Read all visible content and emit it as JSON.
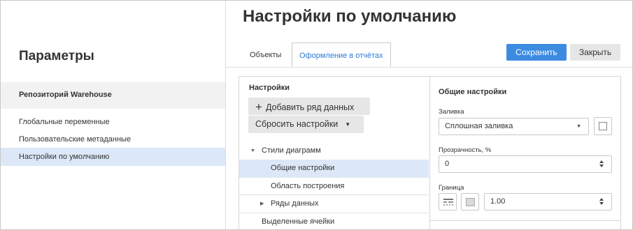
{
  "sidebar": {
    "title": "Параметры",
    "repository": "Репозиторий Warehouse",
    "items": [
      {
        "label": "Глобальные переменные"
      },
      {
        "label": "Пользовательские метаданные"
      },
      {
        "label": "Настройки по умолчанию"
      }
    ]
  },
  "main": {
    "title": "Настройки по умолчанию",
    "tabs": [
      {
        "label": "Объекты"
      },
      {
        "label": "Оформление в отчётах"
      }
    ],
    "buttons": {
      "save": "Сохранить",
      "close": "Закрыть"
    }
  },
  "left_panel": {
    "section_label": "Настройки",
    "add_series": "Добавить ряд данных",
    "reset_settings": "Сбросить настройки",
    "tree": [
      {
        "label": "Стили диаграмм"
      },
      {
        "label": "Общие настройки"
      },
      {
        "label": "Область построения"
      },
      {
        "label": "Ряды данных"
      },
      {
        "label": "Выделенные ячейки"
      }
    ]
  },
  "right_panel": {
    "title": "Общие настройки",
    "fill_label": "Заливка",
    "fill_value": "Сплошная заливка",
    "transparency_label": "Прозрачность, %",
    "transparency_value": "0",
    "border_label": "Граница",
    "border_width": "1.00"
  },
  "colors": {
    "accent": "#3d8be0",
    "selection": "#dce8f8",
    "tab_active_text": "#2d7ad6"
  },
  "icons": {
    "add": "plus-icon",
    "dropdown": "caret-down-icon",
    "tree_expanded": "triangle-down-icon",
    "tree_collapsed": "triangle-right-icon",
    "border_style": "line-style-icon",
    "color": "color-swatch-icon"
  }
}
